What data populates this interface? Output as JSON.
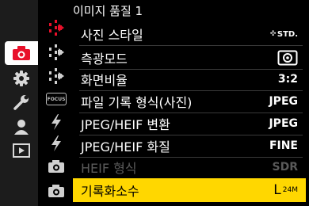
{
  "colors": {
    "accent": "#e8102a",
    "highlight": "#ffd700"
  },
  "sidebar": {
    "items": [
      {
        "icon": "camera-icon",
        "active": true
      },
      {
        "icon": "gear-icon"
      },
      {
        "icon": "wrench-icon"
      },
      {
        "icon": "person-icon"
      },
      {
        "icon": "playback-icon"
      }
    ]
  },
  "tabs": [
    {
      "icon": "red-menu-tab-icon",
      "active": true
    },
    {
      "icon": "menu-tab-icon"
    },
    {
      "icon": "menu-tab-icon"
    },
    {
      "icon": "focus-tab-icon",
      "text": "FOCUS"
    },
    {
      "icon": "flash-icon"
    },
    {
      "icon": "flash-icon"
    },
    {
      "icon": "camera-small-icon"
    },
    {
      "icon": "camera-small-icon"
    }
  ],
  "header": {
    "title": "이미지 품질 1"
  },
  "menu": [
    {
      "label": "사진 스타일",
      "value": "STD.",
      "icon": "photo-style-icon"
    },
    {
      "label": "측광모드",
      "value": "",
      "icon": "metering-icon"
    },
    {
      "label": "화면비율",
      "value": "3:2"
    },
    {
      "label": "파일 기록 형식(사진)",
      "value": "JPEG"
    },
    {
      "label": "JPEG/HEIF 변환",
      "value": "JPEG"
    },
    {
      "label": "JPEG/HEIF 화질",
      "value": "FINE"
    },
    {
      "label": "HEIF 형식",
      "value": "SDR",
      "disabled": true
    },
    {
      "label": "기록화소수",
      "value": "L",
      "value_sub": "24M",
      "selected": true
    }
  ]
}
